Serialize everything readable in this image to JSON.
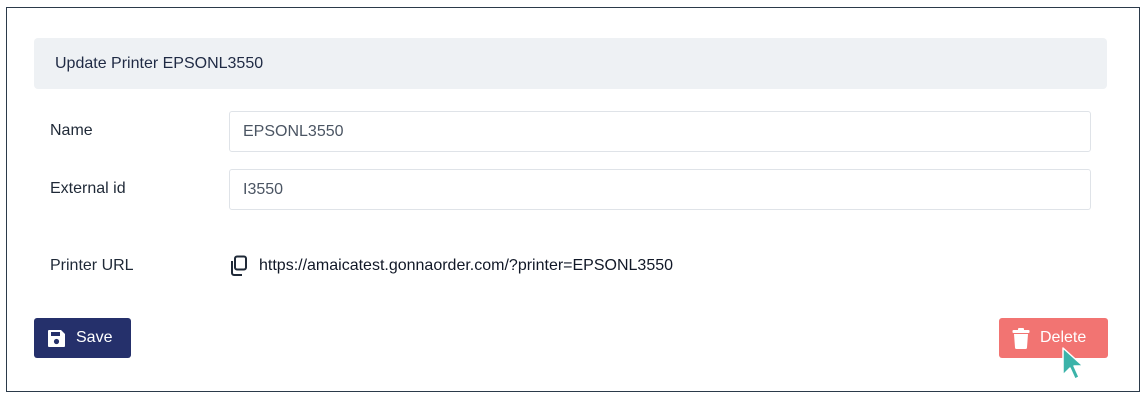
{
  "header": {
    "title": "Update Printer EPSONL3550"
  },
  "form": {
    "name": {
      "label": "Name",
      "value": "EPSONL3550"
    },
    "external_id": {
      "label": "External id",
      "value": "I3550"
    },
    "printer_url": {
      "label": "Printer URL",
      "value": "https://amaicatest.gonnaorder.com/?printer=EPSONL3550"
    }
  },
  "actions": {
    "save_label": "Save",
    "delete_label": "Delete"
  },
  "icons": {
    "copy": "copy-icon",
    "save": "floppy-disk-icon",
    "delete": "trash-icon",
    "cursor": "mouse-pointer-icon"
  },
  "colors": {
    "primary": "#25306b",
    "danger": "#f27472",
    "header_bg": "#eef1f4",
    "cursor": "#3bb3a9"
  }
}
